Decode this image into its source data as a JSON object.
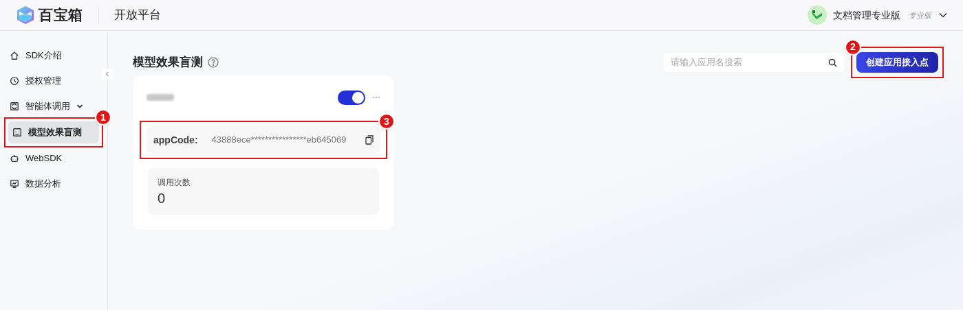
{
  "header": {
    "logo_text": "百宝箱",
    "platform_title": "开放平台",
    "account_name": "文档管理专业版",
    "account_badge": "专业版"
  },
  "sidebar": {
    "items": [
      {
        "label": "SDK介绍",
        "kind": "link",
        "selected": false
      },
      {
        "label": "授权管理",
        "kind": "link",
        "selected": false
      },
      {
        "label": "智能体调用",
        "kind": "group",
        "selected": false
      },
      {
        "label": "模型效果盲测",
        "kind": "link",
        "selected": true,
        "annotation": "1"
      },
      {
        "label": "WebSDK",
        "kind": "link",
        "selected": false
      },
      {
        "label": "数据分析",
        "kind": "link",
        "selected": false
      }
    ]
  },
  "page": {
    "title": "模型效果盲测",
    "search": {
      "placeholder": "请输入应用名搜索"
    },
    "create_button": {
      "label": "创建应用接入点",
      "annotation": "2"
    }
  },
  "cards": [
    {
      "enabled": true,
      "app_code": {
        "label": "appCode:",
        "value": "43888ece****************eb645069",
        "annotation": "3"
      },
      "stat": {
        "label": "调用次数",
        "value": "0"
      }
    }
  ]
}
